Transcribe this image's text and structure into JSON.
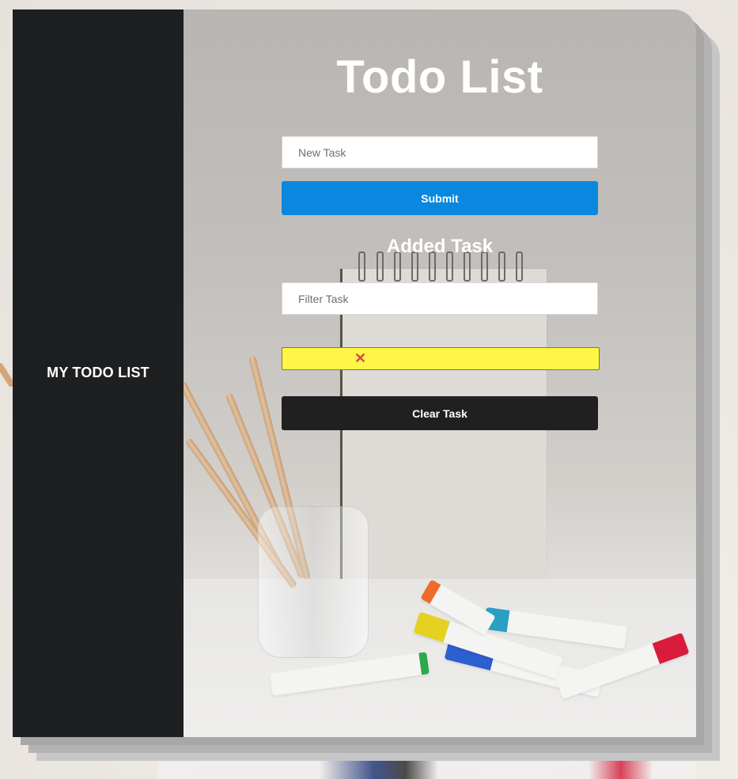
{
  "sidebar": {
    "title": "MY TODO LIST"
  },
  "main": {
    "title": "Todo List",
    "new_task": {
      "placeholder": "New Task",
      "value": ""
    },
    "submit_label": "Submit",
    "added_heading": "Added Task",
    "filter_task": {
      "placeholder": "Filter Task",
      "value": ""
    },
    "task_list": [
      {
        "text": "",
        "delete_icon": "close-icon",
        "delete_glyph": "✕",
        "highlight_color": "#fff546"
      }
    ],
    "clear_label": "Clear Task"
  },
  "colors": {
    "sidebar_bg": "#1e1f21",
    "submit_bg": "#0a88e0",
    "clear_bg": "#212021",
    "delete_icon": "#d14a4a"
  }
}
